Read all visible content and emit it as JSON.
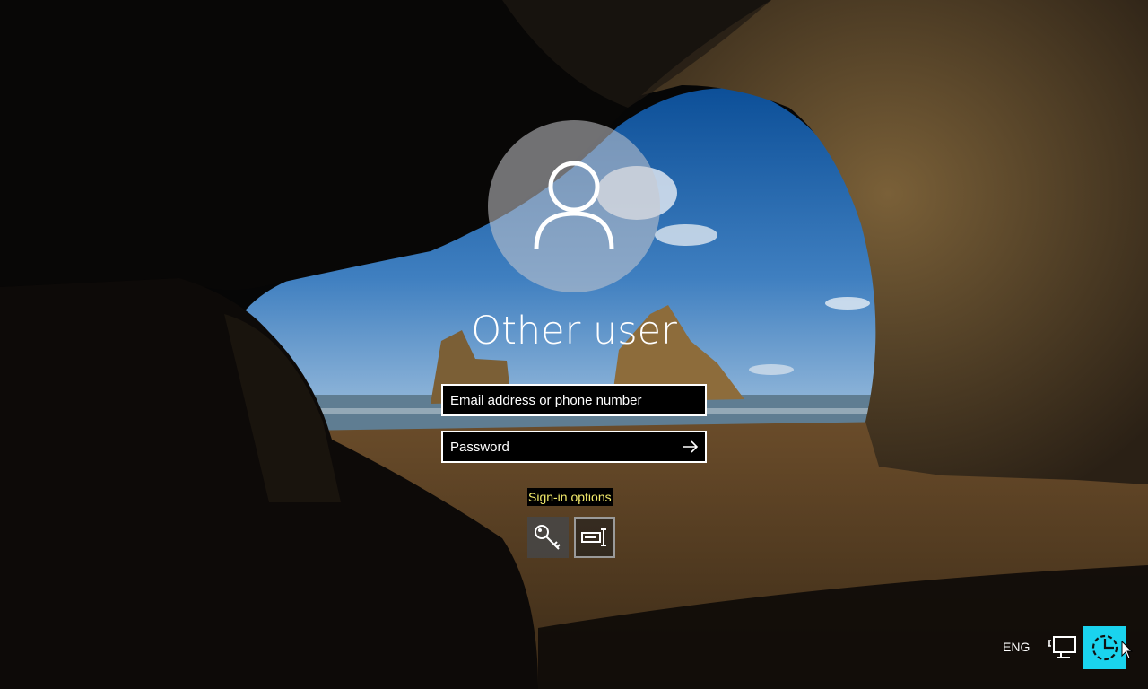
{
  "user": {
    "name": "Other user"
  },
  "fields": {
    "email_placeholder": "Email address or phone number",
    "password_placeholder": "Password"
  },
  "signin_options": {
    "label": "Sign-in options"
  },
  "status": {
    "language": "ENG"
  },
  "icons": {
    "avatar": "user-icon",
    "submit": "arrow-right-icon",
    "key": "key-icon",
    "pin": "pin-icon",
    "network": "network-icon",
    "accessibility": "ease-of-access-icon"
  },
  "colors": {
    "signin_options_text": "#f2ea6b",
    "ease_of_access_bg": "#1ad3ee",
    "field_border": "#ffffff"
  }
}
